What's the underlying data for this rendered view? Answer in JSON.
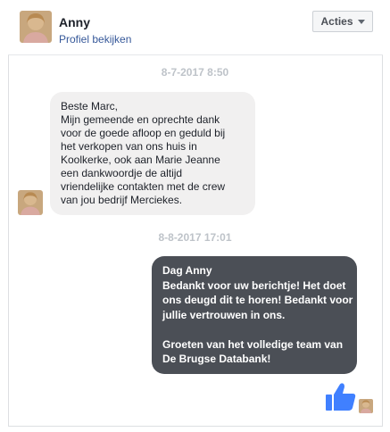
{
  "header": {
    "name": "Anny",
    "profile_link": "Profiel bekijken",
    "actions_label": "Acties"
  },
  "messages": [
    {
      "timestamp": "8-7-2017 8:50",
      "direction": "incoming",
      "lines": [
        "Beste Marc,",
        "Mijn gemeende en oprechte dank",
        "voor de goede afloop en geduld bij",
        "het verkopen van ons huis in",
        "Koolkerke, ook aan Marie Jeanne",
        "een dankwoordje de altijd",
        "vriendelijke contakten met de crew",
        "van jou bedrijf Merciekes."
      ]
    },
    {
      "timestamp": "8-8-2017 17:01",
      "direction": "outgoing",
      "lines": [
        "Dag Anny",
        "Bedankt voor uw berichtje! Het doet",
        "ons deugd dit te horen! Bedankt voor",
        "jullie vertrouwen in ons.",
        "",
        "Groeten van het volledige team van",
        "De Brugse Databank!"
      ]
    }
  ],
  "footer": {
    "reaction_icon": "thumbs-up-icon"
  },
  "colors": {
    "outgoing_bubble": "#4b4f56",
    "incoming_bubble": "#f1f0f0",
    "like_blue": "#4080ff",
    "link": "#365899"
  }
}
